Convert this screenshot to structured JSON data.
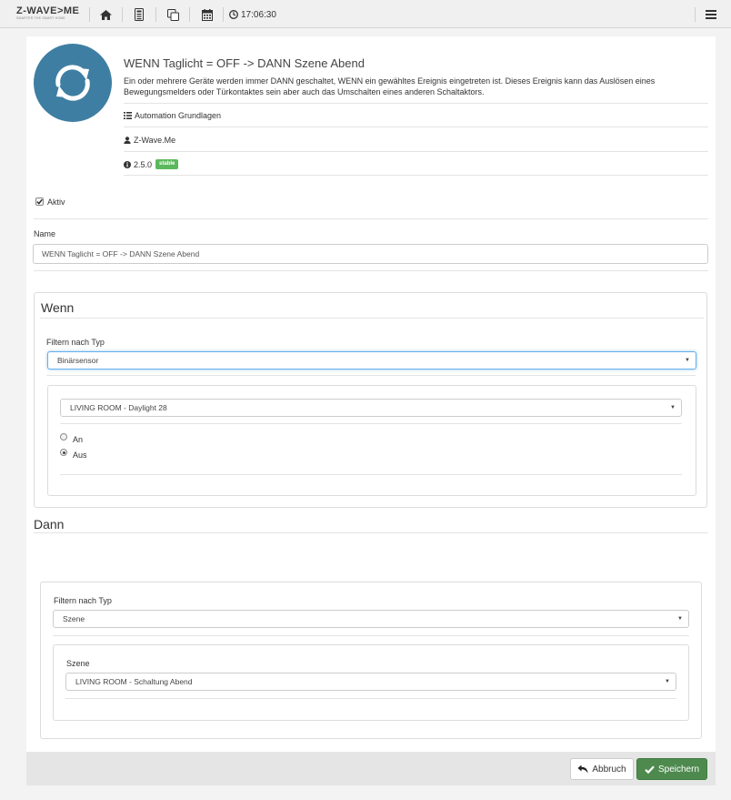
{
  "nav": {
    "logo": "Z-WAVE>ME",
    "logo_sub": "SMARTER THE SMART HOME",
    "time": "17:06:30"
  },
  "app": {
    "title": "WENN Taglicht = OFF -> DANN Szene Abend",
    "description": "Ein oder mehrere Geräte werden immer DANN geschaltet, WENN ein gewähltes Ereignis eingetreten ist. Dieses Ereignis kann das Auslösen eines Bewegungsmelders oder Türkontaktes sein aber auch das Umschalten eines anderen Schaltaktors.",
    "category": "Automation Grundlagen",
    "author": "Z-Wave.Me",
    "version": "2.5.0",
    "badge": "stable",
    "icon_color": "#3f7ea3"
  },
  "active_label": "Aktiv",
  "name": {
    "label": "Name",
    "value": "WENN Taglicht = OFF -> DANN Szene Abend"
  },
  "wenn": {
    "title": "Wenn",
    "filter_label": "Filtern nach Typ",
    "filter_value": "Binärsensor",
    "device_value": "LIVING ROOM - Daylight 28",
    "options": [
      "An",
      "Aus"
    ],
    "selected": "Aus"
  },
  "dann": {
    "title": "Dann",
    "filter_label": "Filtern nach Typ",
    "filter_value": "Szene",
    "scene_label": "Szene",
    "scene_value": "LIVING ROOM - Schaltung Abend"
  },
  "footer": {
    "cancel": "Abbruch",
    "save": "Speichern",
    "save_color": "#4e8a4e"
  }
}
